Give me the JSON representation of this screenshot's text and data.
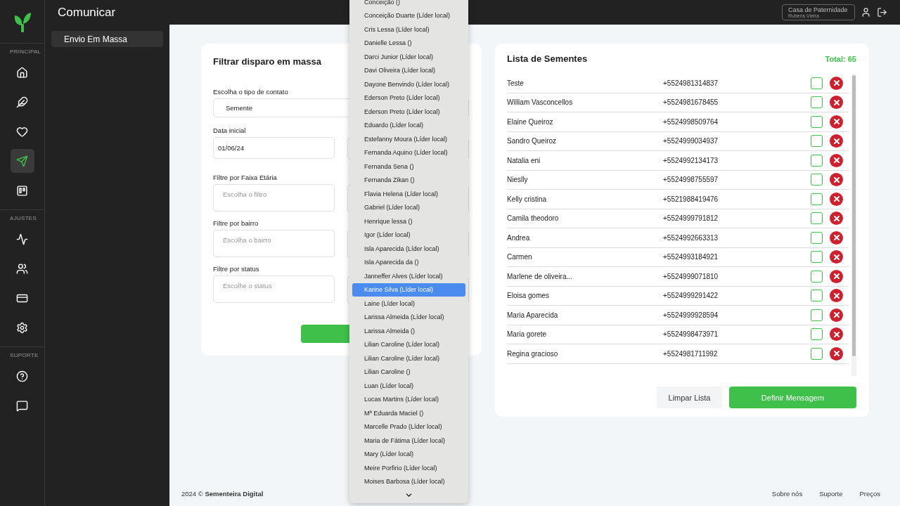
{
  "header": {
    "title": "Comunicar",
    "account": {
      "organization": "Casa de Paternidade",
      "user": "Rubens Vieira"
    }
  },
  "rail": [
    {
      "label": "PRINCIPAL",
      "items": [
        {
          "selected": false
        },
        {
          "selected": false
        },
        {
          "selected": false
        },
        {
          "selected": true
        },
        {
          "selected": false
        }
      ]
    },
    {
      "label": "AJUSTES",
      "items": [
        {
          "selected": false
        },
        {
          "selected": false
        },
        {
          "selected": false
        },
        {
          "selected": false
        }
      ]
    },
    {
      "label": "SUPORTE",
      "items": [
        {
          "selected": false
        },
        {
          "selected": false
        }
      ]
    }
  ],
  "submenu": [
    {
      "label": "Envio Em Massa",
      "selected": true
    }
  ],
  "filter_card": {
    "title": "Filtrar disparo em massa",
    "fields": [
      {
        "label": "Escolha o tipo de contato",
        "value": "Semente",
        "kind": "select"
      },
      {
        "label": "Data inicial",
        "value": "01/06/24",
        "kind": "input"
      },
      {
        "label": "Filtre por Faixa Etária",
        "placeholder": "Escolha o filtro",
        "kind": "multi"
      },
      {
        "label": "Filtre por bairro",
        "placeholder": "Escolha o bairro",
        "kind": "multi"
      },
      {
        "label": "Filtre por status",
        "placeholder": "Escolhe o status",
        "kind": "multi"
      }
    ]
  },
  "dropdown": {
    "options": [
      {
        "label": "Conceição ()",
        "selected": false
      },
      {
        "label": "Conceição Duarte (Líder local)",
        "selected": false
      },
      {
        "label": "Cris Lessa (Líder local)",
        "selected": false
      },
      {
        "label": "Danielle Lessa ()",
        "selected": false
      },
      {
        "label": "Darci Junior (Líder local)",
        "selected": false
      },
      {
        "label": "Davi Oliveira (Líder local)",
        "selected": false
      },
      {
        "label": "Dayone Benvindo (Líder local)",
        "selected": false
      },
      {
        "label": "Ederson Preto (Líder local)",
        "selected": false
      },
      {
        "label": "Ederson Preto (Líder local)",
        "selected": false
      },
      {
        "label": "Eduardo (Líder local)",
        "selected": false
      },
      {
        "label": "Estefanny Moura (Líder local)",
        "selected": false
      },
      {
        "label": "Fernanda Aquino (Líder local)",
        "selected": false
      },
      {
        "label": "Fernanda Sena ()",
        "selected": false
      },
      {
        "label": "Fernanda Zikan ()",
        "selected": false
      },
      {
        "label": "Flavia Helena (Líder local)",
        "selected": false
      },
      {
        "label": "Gabriel (Líder local)",
        "selected": false
      },
      {
        "label": "Henrique lessa ()",
        "selected": false
      },
      {
        "label": "Igor (Líder local)",
        "selected": false
      },
      {
        "label": "Isla Aparecida (Líder local)",
        "selected": false
      },
      {
        "label": "Isla Aparecida da ()",
        "selected": false
      },
      {
        "label": "Janneffer Alves (Líder local)",
        "selected": false
      },
      {
        "label": "Karine Silva (Líder local)",
        "selected": true
      },
      {
        "label": "Laine (Líder local)",
        "selected": false
      },
      {
        "label": "Larissa Almeida (Líder local)",
        "selected": false
      },
      {
        "label": "Larissa Almeida ()",
        "selected": false
      },
      {
        "label": "Lilian Caroline (Líder local)",
        "selected": false
      },
      {
        "label": "Lilian Caroline (Líder local)",
        "selected": false
      },
      {
        "label": "Lilian Caroline ()",
        "selected": false
      },
      {
        "label": "Luan (Líder local)",
        "selected": false
      },
      {
        "label": "Lucas Martins (Líder local)",
        "selected": false
      },
      {
        "label": "Mª Eduarda Maciel ()",
        "selected": false
      },
      {
        "label": "Marcelle Prado (Líder local)",
        "selected": false
      },
      {
        "label": "Maria de Fátima (Líder local)",
        "selected": false
      },
      {
        "label": "Mary (Líder local)",
        "selected": false
      },
      {
        "label": "Meire Porfirio (Líder local)",
        "selected": false
      },
      {
        "label": "Moises Barbosa (Líder local)",
        "selected": false
      }
    ]
  },
  "list_card": {
    "title": "Lista de Sementes",
    "total": "Total: 65",
    "rows": [
      {
        "name": "Teste",
        "phone": "+5524981314837",
        "checked": false
      },
      {
        "name": "William Vasconcellos",
        "phone": "+5524981678455",
        "checked": false
      },
      {
        "name": "Elaine Queiroz",
        "phone": "+5524998509764",
        "checked": false
      },
      {
        "name": "Sandro Queiroz",
        "phone": "+5524999034937",
        "checked": false
      },
      {
        "name": "Natalia eni",
        "phone": "+5524992134173",
        "checked": false
      },
      {
        "name": "Nieslly",
        "phone": "+5524998755597",
        "checked": false
      },
      {
        "name": "Kelly cristina",
        "phone": "+5521988419476",
        "checked": false
      },
      {
        "name": "Camila theodoro",
        "phone": "+5524999791812",
        "checked": false
      },
      {
        "name": "Andrea",
        "phone": "+5524992663313",
        "checked": false
      },
      {
        "name": "Carmen",
        "phone": "+5524993184921",
        "checked": false
      },
      {
        "name": "Marlene de oliveira...",
        "phone": "+5524999071810",
        "checked": false
      },
      {
        "name": "Eloisa gomes",
        "phone": "+5524999291422",
        "checked": false
      },
      {
        "name": "Maria Aparecida",
        "phone": "+5524999928594",
        "checked": false
      },
      {
        "name": "Maria gorete",
        "phone": "+5524998473971",
        "checked": false
      },
      {
        "name": "Regina gracioso",
        "phone": "+5524981711992",
        "checked": false
      }
    ],
    "buttons": [
      {
        "label": "Limpar Lista",
        "kind": "secondary"
      },
      {
        "label": "Definir Mensagem",
        "kind": "primary"
      }
    ]
  },
  "footer": {
    "copyright": "2024 © **Sementeira Digital**",
    "links": [
      "Sobre nós",
      "Suporte",
      "Preços"
    ]
  }
}
